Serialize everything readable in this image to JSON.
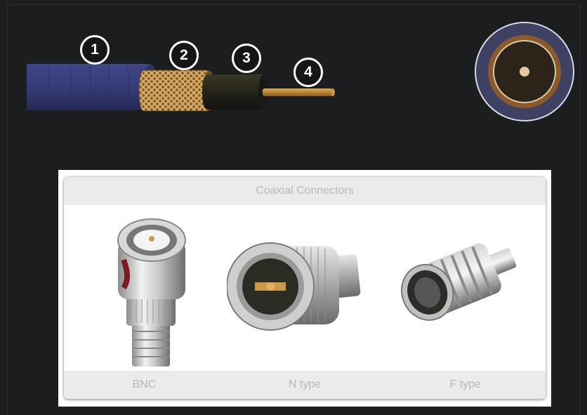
{
  "cable_diagram": {
    "callouts": [
      "1",
      "2",
      "3",
      "4"
    ],
    "layers": [
      "outer-jacket",
      "braided-shield",
      "dielectric-insulator",
      "copper-center-conductor"
    ],
    "colors": {
      "jacket": "#353a72",
      "shield": "#b0813f",
      "dielectric": "#23221a",
      "conductor": "#b9862c"
    }
  },
  "cross_section": {
    "colors": {
      "outer": "#3f4163",
      "shield": "#8a5a2a",
      "dielectric": "#2a2518",
      "core": "#e8c7a0"
    }
  },
  "connectors_panel": {
    "title": "Coaxial Connectors",
    "items": [
      {
        "label": "BNC",
        "icon": "bnc-connector-icon"
      },
      {
        "label": "N type",
        "icon": "n-type-connector-icon"
      },
      {
        "label": "F type",
        "icon": "f-type-connector-icon"
      }
    ]
  }
}
